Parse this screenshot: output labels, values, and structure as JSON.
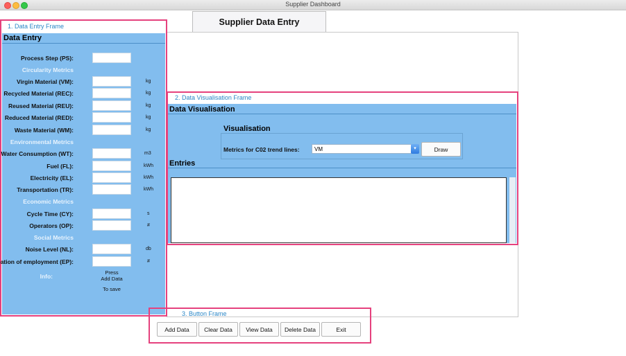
{
  "window": {
    "title": "Supplier Dashboard"
  },
  "header": {
    "title": "Supplier Data Entry"
  },
  "frames": {
    "entry": "1. Data Entry Frame",
    "vis": "2. Data Visualisation Frame",
    "button": "3. Button Frame"
  },
  "entry": {
    "heading": "Data Entry",
    "process_step": "Process Step (PS):",
    "circularity": {
      "title": "Circularity Metrics",
      "rows": [
        {
          "label": "Virgin Material (VM):",
          "unit": "kg"
        },
        {
          "label": "Recycled Material (REC):",
          "unit": "kg"
        },
        {
          "label": "Reused Material (REU):",
          "unit": "kg"
        },
        {
          "label": "Reduced Material (RED):",
          "unit": "kg"
        },
        {
          "label": "Waste Material (WM):",
          "unit": "kg"
        }
      ]
    },
    "environmental": {
      "title": "Environmental Metrics",
      "rows": [
        {
          "label": "Water Consumption (WT):",
          "unit": "m3"
        },
        {
          "label": "Fuel (FL):",
          "unit": "kWh"
        },
        {
          "label": "Electricity (EL):",
          "unit": "kWh"
        },
        {
          "label": "Transportation (TR):",
          "unit": "kWh"
        }
      ]
    },
    "economic": {
      "title": "Economic Metrics",
      "rows": [
        {
          "label": "Cycle Time (CY):",
          "unit": "s"
        },
        {
          "label": "Operators (OP):",
          "unit": "#"
        }
      ]
    },
    "social": {
      "title": "Social Metrics",
      "rows": [
        {
          "label": "Noise Level (NL):",
          "unit": "db"
        },
        {
          "label": "Creation of employment (EP):",
          "unit": "#"
        }
      ]
    },
    "info_label": "Info:",
    "info_line1": "Press",
    "info_line2": "Add Data",
    "info_line3": "To save"
  },
  "vis": {
    "heading": "Data Visualisation",
    "sub_heading": "Visualisation",
    "metrics_label": "Metrics for C02 trend lines:",
    "metric_value": "VM",
    "draw": "Draw",
    "entries": "Entries"
  },
  "buttons": {
    "add": "Add Data",
    "clear": "Clear Data",
    "view": "View Data",
    "delete": "Delete Data",
    "exit": "Exit"
  }
}
